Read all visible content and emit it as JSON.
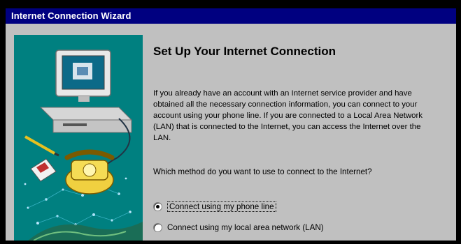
{
  "window": {
    "title": "Internet Connection Wizard"
  },
  "main": {
    "heading": "Set Up Your Internet Connection",
    "paragraph": "If you already have an account with an Internet service provider and have obtained all the necessary connection information, you can connect to your account using your phone line. If you are connected to a Local Area Network (LAN) that is connected to the Internet, you can access the Internet over the LAN.",
    "question": "Which method do you want to use to connect to the Internet?",
    "options": [
      {
        "label": "Connect using my phone line",
        "selected": true
      },
      {
        "label": "Connect using my local area network (LAN)",
        "selected": false
      }
    ]
  },
  "side_panel": {
    "illustration": "computer-with-telephone-illustration"
  },
  "colors": {
    "titlebar": "#000080",
    "panel": "#008080",
    "window": "#c0c0c0"
  }
}
